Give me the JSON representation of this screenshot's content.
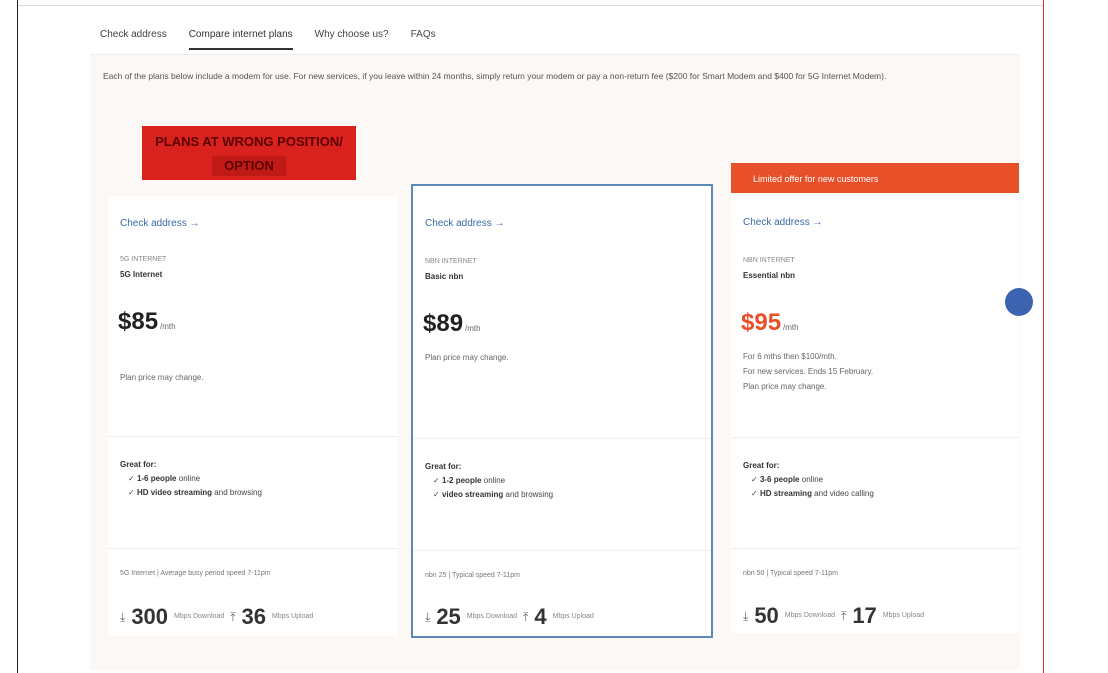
{
  "tabs": [
    "Check address",
    "Compare internet plans",
    "Why choose us?",
    "FAQs"
  ],
  "active_tab": 1,
  "intro": "Each of the plans below include a modem for use. For new services, if you leave within 24 months, simply return your modem or pay a non-return fee ($200 for Smart Modem and $400 for 5G Internet Modem).",
  "promo_label": {
    "line1": "PLANS AT WRONG POSITION/",
    "line2": "OPTION"
  },
  "ribbon": "Limited offer for new customers",
  "plans": [
    {
      "check_link": "Check address →",
      "type": "5G Internet",
      "name": "5G Internet",
      "price": "$85",
      "per": "/mth",
      "notes": [
        "Plan price may change."
      ],
      "great_for": "Great for:",
      "items": [
        {
          "bold": "1-6 people",
          "text": " online"
        },
        {
          "bold": "HD video streaming",
          "text": " and browsing"
        }
      ],
      "speed_head": "5G Internet | Average busy period speed 7-11pm",
      "download": "300",
      "upload": "36",
      "unit_dl": "Mbps Download",
      "unit_ul": "Mbps Upload"
    },
    {
      "check_link": "Check address →",
      "type": "nbn Internet",
      "name": "Basic nbn",
      "price": "$89",
      "per": "/mth",
      "notes": [
        "Plan price may change."
      ],
      "great_for": "Great for:",
      "items": [
        {
          "bold": "1-2 people",
          "text": " online"
        },
        {
          "bold": "video streaming",
          "text": " and browsing"
        }
      ],
      "speed_head": "nbn 25 | Typical speed 7-11pm",
      "download": "25",
      "upload": "4",
      "unit_dl": "Mbps Download",
      "unit_ul": "Mbps Upload"
    },
    {
      "check_link": "Check address →",
      "type": "nbn Internet",
      "name": "Essential nbn",
      "price": "$95",
      "per": "/mth",
      "notes": [
        "For 6 mths then $100/mth.",
        "For new services. Ends 15 February.",
        "Plan price may change."
      ],
      "great_for": "Great for:",
      "items": [
        {
          "bold": "3-6 people",
          "text": " online"
        },
        {
          "bold": "HD streaming",
          "text": " and video calling"
        }
      ],
      "speed_head": "nbn 50 | Typical speed 7-11pm",
      "download": "50",
      "upload": "17",
      "unit_dl": "Mbps Download",
      "unit_ul": "Mbps Upload"
    }
  ],
  "colors": {
    "accent_blue": "#3a69a8",
    "ribbon_orange": "#e8502a",
    "promo_red": "#d9211d",
    "selected_border": "#5b89b8"
  }
}
